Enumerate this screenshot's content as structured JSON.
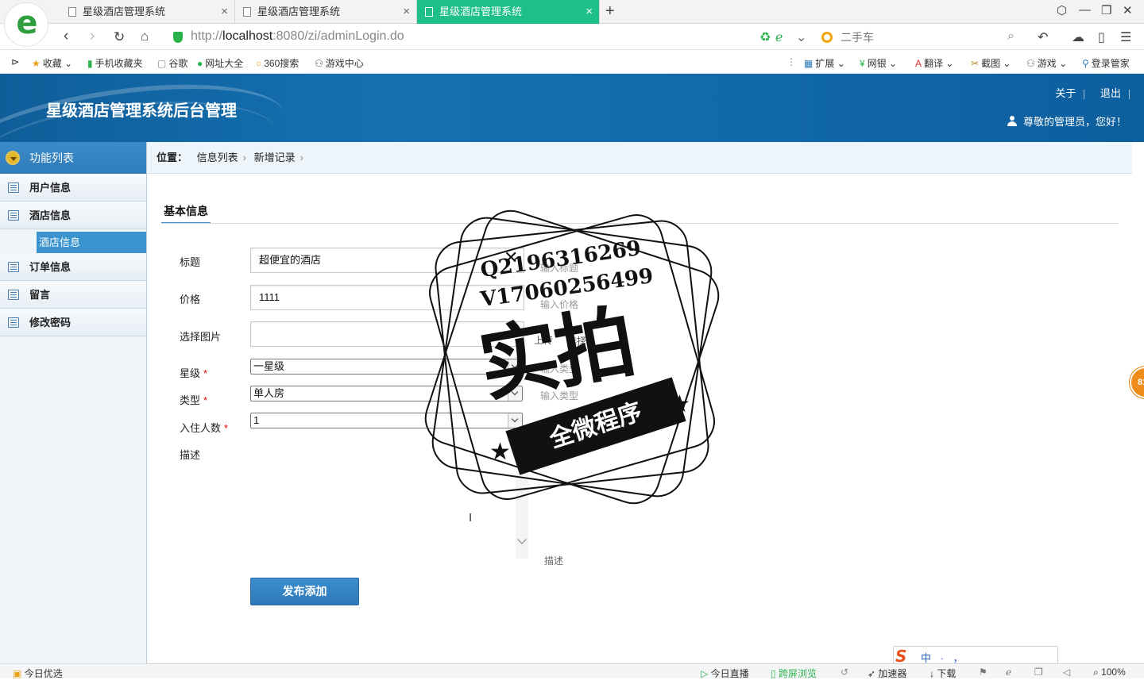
{
  "browser": {
    "tabs": [
      {
        "label": "星级酒店管理系统",
        "active": false
      },
      {
        "label": "星级酒店管理系统",
        "active": false
      },
      {
        "label": "星级酒店管理系统",
        "active": true
      }
    ],
    "tab_close": "×",
    "new_tab": "+",
    "url_prefix": "http://",
    "url_host": "localhost",
    "url_rest": ":8080/zi/adminLogin.do",
    "search_placeholder": "二手车",
    "bookmarks": [
      "收藏",
      "手机收藏夹",
      "谷歌",
      "网址大全",
      "360搜索",
      "游戏中心"
    ],
    "toolbar_right": [
      "扩展",
      "网银",
      "翻译",
      "截图",
      "游戏",
      "登录管家"
    ],
    "accent_color": "#1fbf8a"
  },
  "header": {
    "title": "星级酒店管理系统后台管理",
    "links": [
      "关于",
      "退出"
    ],
    "greeting": "尊敬的管理员，您好！",
    "bg_color": "#1571b2"
  },
  "sidebar": {
    "heading": "功能列表",
    "items": [
      "用户信息",
      "酒店信息",
      "订单信息",
      "留言",
      "修改密码"
    ],
    "submenu": "酒店信息"
  },
  "breadcrumb": {
    "label": "位置：",
    "items": [
      "信息列表",
      "新增记录"
    ],
    "sep": "›"
  },
  "form": {
    "section": "基本信息",
    "title_label": "标题",
    "title_value": "超便宜的酒店",
    "title_hint": "输入标题",
    "price_label": "价格",
    "price_value": "1111",
    "price_hint": "输入价格",
    "image_label": "选择图片",
    "upload_hint": "上传",
    "choose_hint": "选择",
    "star_label": "星级",
    "star_value": "一星级",
    "star_hint": "输入类型",
    "type_label": "类型",
    "type_value": "单人房",
    "type_hint": "输入类型",
    "guests_label": "入住人数",
    "guests_value": "1",
    "desc_label": "描述",
    "desc_hint": "描述",
    "required_mark": "*",
    "submit": "发布添加"
  },
  "watermark": {
    "line1": "Q2196316269",
    "line2": "V17060256499",
    "big": "实拍",
    "ribbon": "全微程序"
  },
  "side_badge": "81",
  "statusbar": {
    "left": "今日优选",
    "items": [
      "今日直播",
      "跨屏浏览",
      "加速器",
      "下载"
    ],
    "zoom": "100%"
  },
  "ime": {
    "brand": "S",
    "text": "中 ·  ， "
  }
}
